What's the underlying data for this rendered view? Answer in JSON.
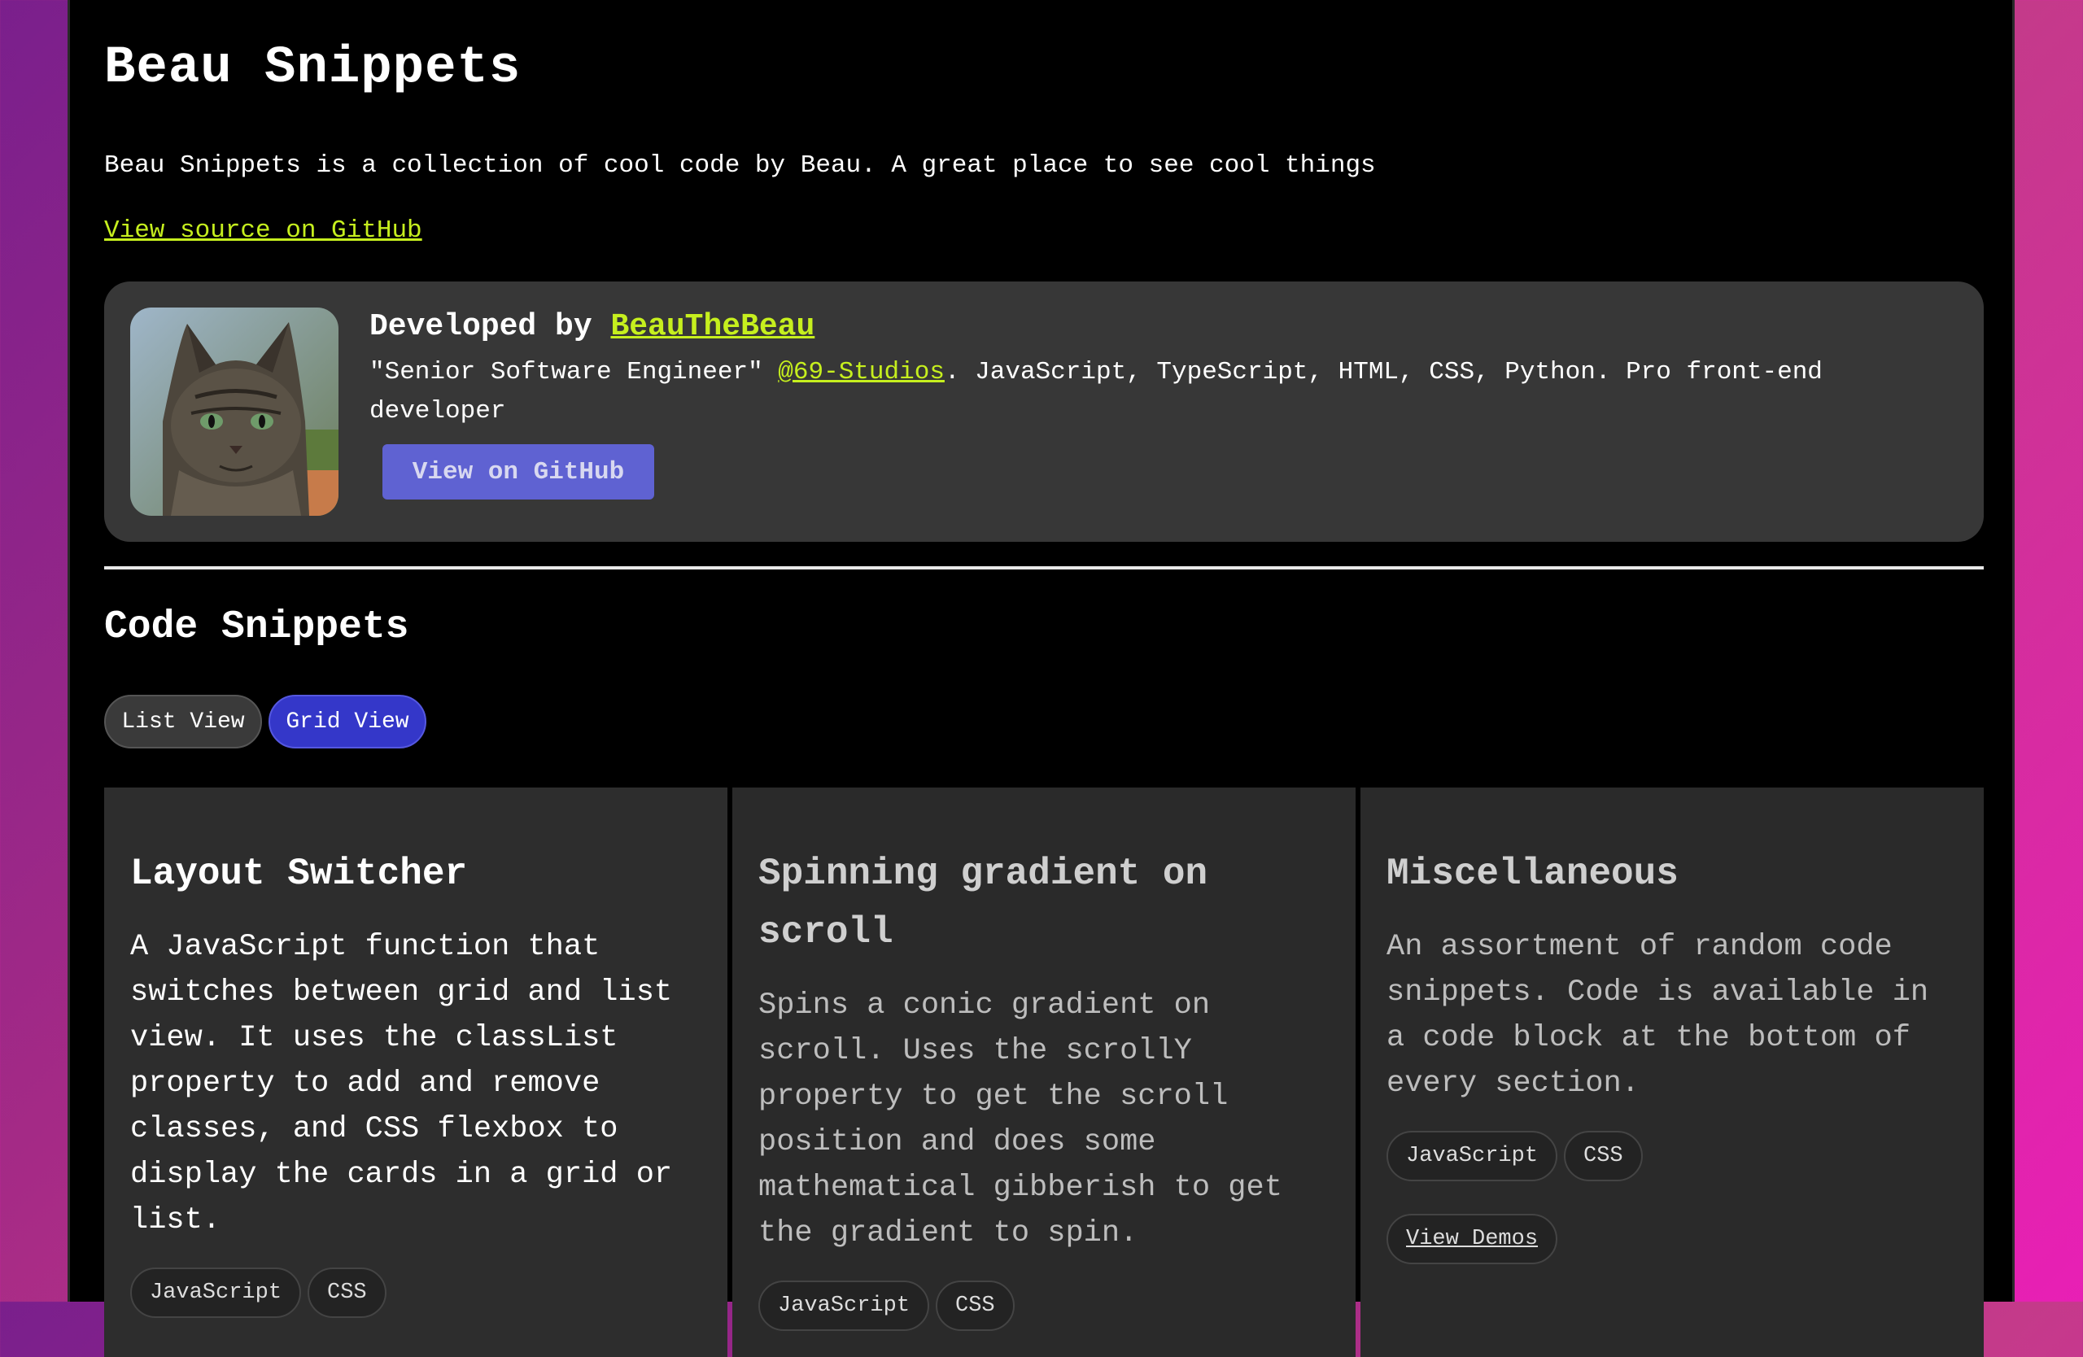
{
  "header": {
    "title": "Beau Snippets",
    "description": "Beau Snippets is a collection of cool code by Beau. A great place to see cool things",
    "source_link": "View source on GitHub"
  },
  "developer": {
    "prefix": "Developed by ",
    "name": "BeauTheBeau",
    "bio_start": "\"Senior Software Engineer\" ",
    "bio_link": "@69-Studios",
    "bio_end": ". JavaScript, TypeScript, HTML, CSS, Python. Pro front-end developer",
    "button": "View on GitHub",
    "avatar": "cat-avatar"
  },
  "snippets": {
    "heading": "Code Snippets",
    "view_toggle": {
      "list": "List View",
      "grid": "Grid View",
      "active": "grid"
    },
    "cards": [
      {
        "title": "Layout Switcher",
        "description": "A JavaScript function that switches between grid and list view. It uses the classList property to add and remove classes, and CSS flexbox to display the cards in a grid or list.",
        "tags": [
          "JavaScript",
          "CSS"
        ]
      },
      {
        "title": "Spinning gradient on scroll",
        "description": "Spins a conic gradient on scroll. Uses the scrollY property to get the scroll position and does some mathematical gibberish to get the gradient to spin.",
        "tags": [
          "JavaScript",
          "CSS"
        ]
      },
      {
        "title": "Miscellaneous",
        "description": "An assortment of random code snippets. Code is available in a code block at the bottom of every section.",
        "tags": [
          "JavaScript",
          "CSS"
        ],
        "demo_button": "View Demos"
      }
    ]
  },
  "colors": {
    "accent": "#c6ef1e",
    "button": "#5f62d2",
    "active_toggle": "#3437c9"
  }
}
